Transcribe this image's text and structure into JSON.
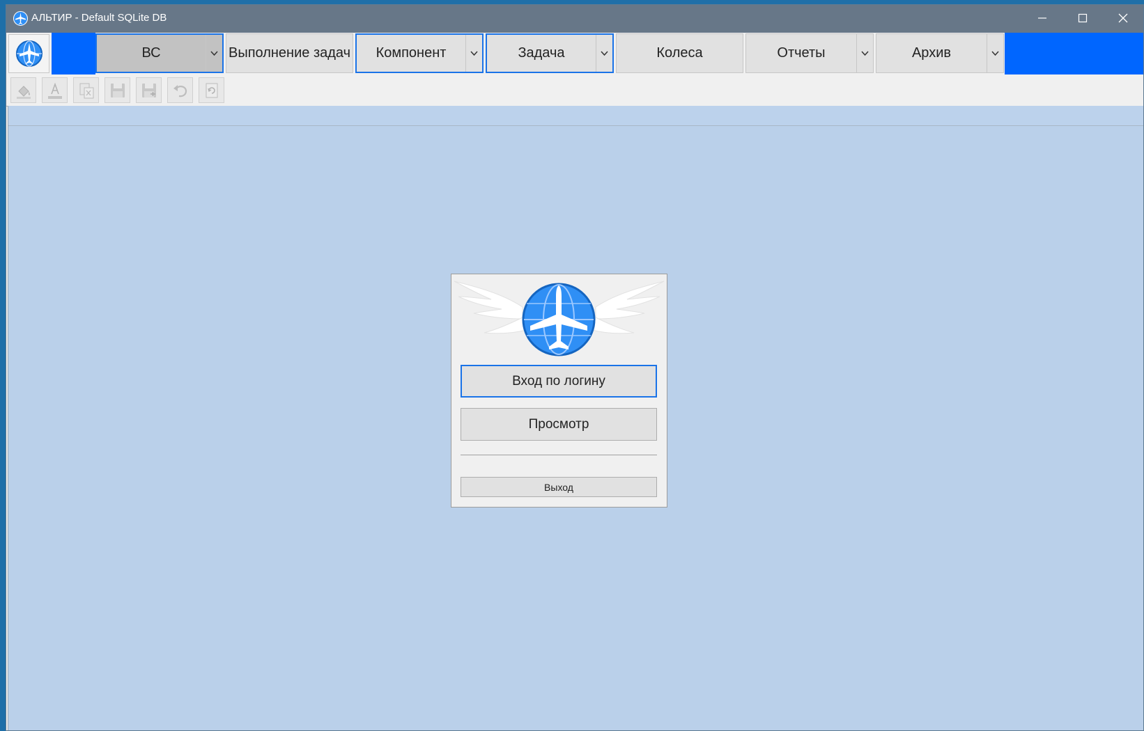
{
  "window": {
    "title": "АЛЬТИР - Default SQLite DB",
    "app_icon": "airplane-globe-icon",
    "controls": [
      "minimize-icon",
      "maximize-icon",
      "close-icon"
    ]
  },
  "menubar": {
    "logo": "airplane-globe-icon",
    "items": [
      {
        "label": "ВС",
        "has_dropdown": true,
        "state": "pressed"
      },
      {
        "label": "Выполнение задач",
        "has_dropdown": false
      },
      {
        "label": "Компонент",
        "has_dropdown": true,
        "state": "selected"
      },
      {
        "label": "Задача",
        "has_dropdown": true,
        "state": "selected"
      },
      {
        "label": "Колеса",
        "has_dropdown": false
      },
      {
        "label": "Отчеты",
        "has_dropdown": true
      },
      {
        "label": "Архив",
        "has_dropdown": true
      }
    ]
  },
  "toolbar": {
    "buttons": [
      {
        "icon": "paint-bucket-icon",
        "enabled": false
      },
      {
        "icon": "font-color-icon",
        "enabled": false
      },
      {
        "icon": "export-excel-icon",
        "enabled": false
      },
      {
        "icon": "save-icon",
        "enabled": false
      },
      {
        "icon": "save-as-icon",
        "enabled": false
      },
      {
        "icon": "undo-icon",
        "enabled": false
      },
      {
        "icon": "refresh-icon",
        "enabled": false
      }
    ]
  },
  "login_dialog": {
    "logo": "winged-airplane-globe-logo",
    "login_button": "Вход по логину",
    "view_button": "Просмотр",
    "exit_button": "Выход"
  },
  "colors": {
    "accent": "#1a73e8",
    "menu_blue": "#0066ff",
    "titlebar": "#677788",
    "workspace": "#bad0ea"
  }
}
